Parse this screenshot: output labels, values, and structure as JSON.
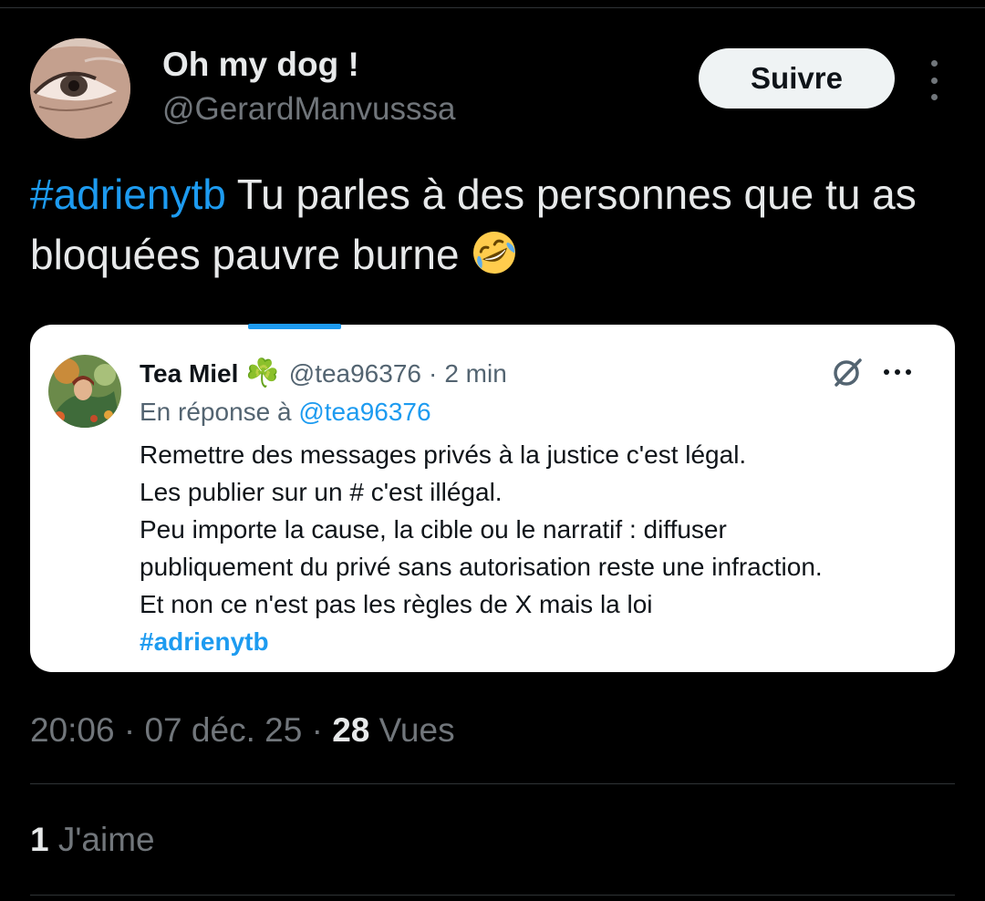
{
  "author": {
    "display_name": "Oh my dog !",
    "handle": "@GerardManvusssa",
    "avatar_icon": "eye-photo-avatar"
  },
  "follow_button": {
    "label": "Suivre"
  },
  "more_icon": "more-vertical-icon",
  "tweet": {
    "hashtag": "#adrienytb",
    "text": " Tu parles à des personnes que tu as bloquées pauvre burne ",
    "emoji": "rolling-on-floor-laughing-emoji"
  },
  "quote": {
    "name": "Tea Miel",
    "emoji": "☘️",
    "handle": "@tea96376",
    "separator": "·",
    "time": "2 min",
    "reply_prefix": "En réponse à ",
    "reply_mention": "@tea96376",
    "lines": [
      "Remettre des messages privés à la justice c'est légal.",
      "Les publier sur un # c'est illégal.",
      "Peu importe la cause, la cible ou le narratif : diffuser",
      "publiquement du privé sans autorisation reste une infraction.",
      "Et non ce n'est pas les règles de X mais la loi"
    ],
    "hashtag": "#adrienytb",
    "grok_icon": "grok-slash-circle-icon",
    "more_icon": "more-horizontal-icon"
  },
  "meta": {
    "time": "20:06",
    "separator": " · ",
    "date": "07 déc. 25",
    "views_count": "28",
    "views_label": " Vues"
  },
  "likes": {
    "count": "1",
    "label": " J'aime"
  },
  "colors": {
    "background": "#000000",
    "text_primary": "#e7e9ea",
    "text_secondary": "#71767b",
    "accent": "#1d9bf0",
    "button_bg": "#eff3f4"
  }
}
